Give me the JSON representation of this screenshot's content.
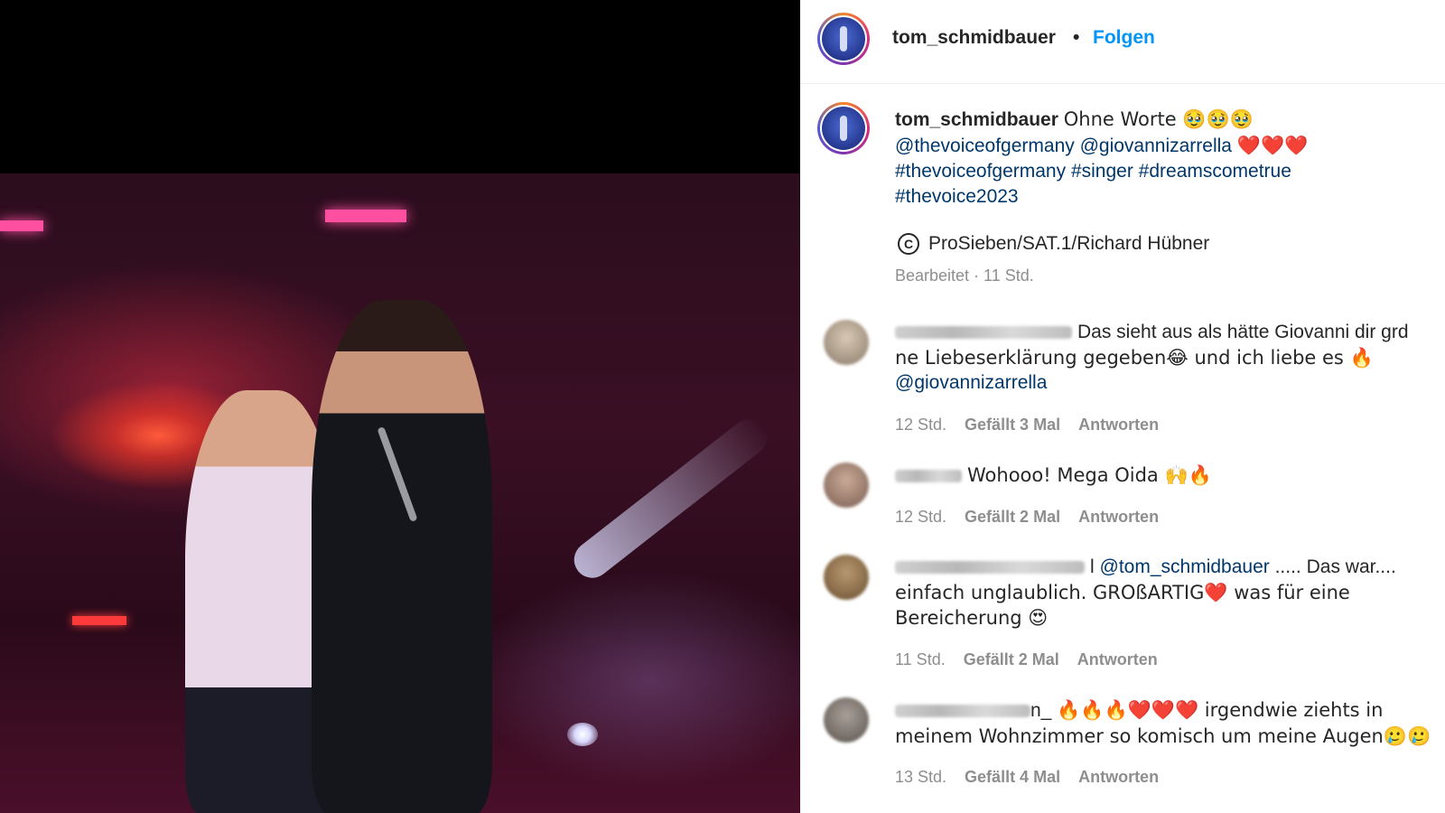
{
  "post": {
    "username": "tom_schmidbauer",
    "separator": "•",
    "follow_label": "Folgen"
  },
  "caption": {
    "username": "tom_schmidbauer",
    "text": "Ohne Worte 🥹🥹🥹",
    "mentions": "@thevoiceofgermany @giovannizarrella",
    "mentions_emoji": "❤️❤️❤️",
    "hashtags_line1": "#thevoiceofgermany #singer #dreamscometrue",
    "hashtags_line2": "#thevoice2023",
    "credit": "ProSieben/SAT.1/Richard Hübner",
    "copyright_symbol": "C",
    "edited": "Bearbeitet · 11 Std."
  },
  "comments": [
    {
      "line1": "Das sieht aus als hätte Giovanni dir grd",
      "line2": "ne Liebeserklärung gegeben😂 und ich liebe es 🔥",
      "line3": "@giovannizarrella",
      "time": "12 Std.",
      "likes": "Gefällt 3 Mal",
      "reply": "Antworten"
    },
    {
      "line1": "Wohooo! Mega Oida 🙌🔥",
      "time": "12 Std.",
      "likes": "Gefällt 2 Mal",
      "reply": "Antworten"
    },
    {
      "name_suffix": "l",
      "mention": "@tom_schmidbauer",
      "line1_rest": "..... Das war....",
      "line2": "einfach unglaublich. GROßARTIG❤️ was für eine",
      "line3": "Bereicherung 😍",
      "time": "11 Std.",
      "likes": "Gefällt 2 Mal",
      "reply": "Antworten"
    },
    {
      "name_suffix": "n_",
      "line1": "🔥🔥🔥❤️❤️❤️ irgendwie ziehts in",
      "line2": "meinem Wohnzimmer so komisch um meine Augen🥲🥲",
      "time": "13 Std.",
      "likes": "Gefällt 4 Mal",
      "reply": "Antworten"
    }
  ],
  "colors": {
    "accent_blue": "#0095f6",
    "link_blue": "#00376b",
    "meta_gray": "#8e8e8e"
  }
}
